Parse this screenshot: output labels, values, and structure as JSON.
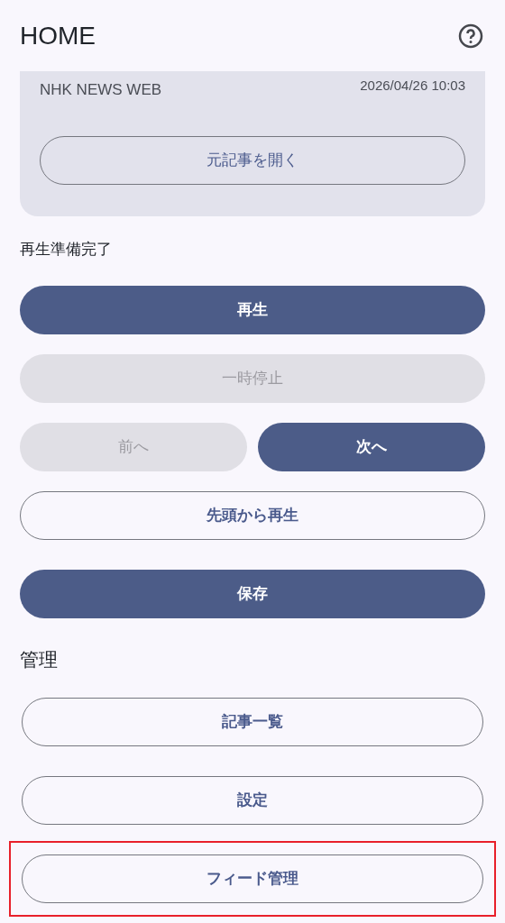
{
  "header": {
    "title": "HOME"
  },
  "article_card": {
    "source": "NHK NEWS WEB",
    "date": "2026/04/26 10:03",
    "open_button": "元記事を開く"
  },
  "status": "再生準備完了",
  "playback_buttons": [
    {
      "label": "再生",
      "kind": "filled",
      "disabled": false
    },
    {
      "label": "一時停止",
      "kind": "filled",
      "disabled": true
    }
  ],
  "nav_buttons": [
    {
      "label": "前へ",
      "kind": "filled",
      "disabled": true
    },
    {
      "label": "次へ",
      "kind": "filled",
      "disabled": false
    }
  ],
  "restart_button": {
    "label": "先頭から再生",
    "kind": "outlined",
    "disabled": false
  },
  "save_button": {
    "label": "保存",
    "kind": "filled",
    "disabled": false
  },
  "manage": {
    "heading": "管理",
    "buttons": [
      {
        "label": "記事一覧",
        "highlighted": false
      },
      {
        "label": "設定",
        "highlighted": false
      },
      {
        "label": "フィード管理",
        "highlighted": true
      }
    ]
  }
}
